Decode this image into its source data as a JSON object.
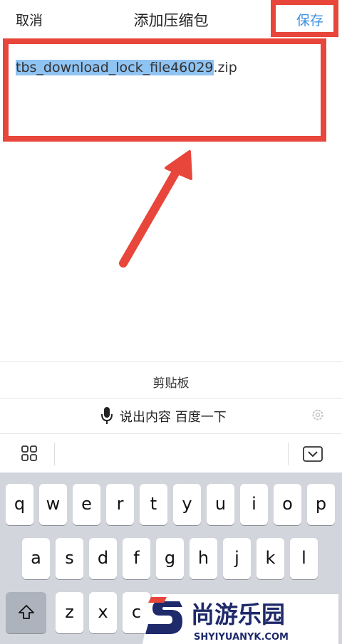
{
  "header": {
    "cancel_label": "取消",
    "title": "添加压缩包",
    "save_label": "保存"
  },
  "filename": {
    "selected": "tbs_download_lock_file46029",
    "extension": ".zip"
  },
  "suggestions": {
    "clipboard_label": "剪贴板",
    "voice_label": "说出内容 百度一下"
  },
  "keyboard": {
    "row1": [
      "q",
      "w",
      "e",
      "r",
      "t",
      "y",
      "u",
      "i",
      "o",
      "p"
    ],
    "row2": [
      "a",
      "s",
      "d",
      "f",
      "g",
      "h",
      "j",
      "k",
      "l"
    ],
    "row3": [
      "z",
      "x",
      "c"
    ]
  },
  "watermark": {
    "name": "尚游乐园",
    "site": "SHYIYUANYK.COM"
  },
  "colors": {
    "accent": "#3c8fe0",
    "annotation": "#e8463a",
    "selection": "#8fc3f2",
    "keyboard_bg": "#d2d5db"
  }
}
